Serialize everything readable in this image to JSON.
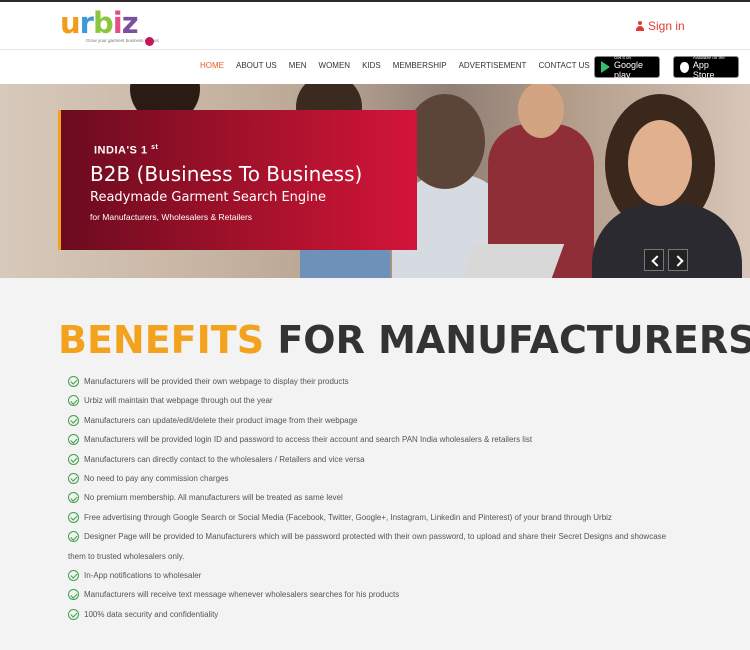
{
  "header": {
    "logo_text": "urbiz",
    "logo_tagline": "Grow your garment business with us",
    "signin_label": "Sign in"
  },
  "nav": {
    "items": [
      "HOME",
      "ABOUT US",
      "MEN",
      "WOMEN",
      "KIDS",
      "MEMBERSHIP",
      "ADVERTISEMENT",
      "CONTACT US"
    ],
    "active": "HOME"
  },
  "stores": {
    "google_small": "Get it on",
    "google_big": "Google play",
    "apple_small": "Available on the",
    "apple_big": "App Store"
  },
  "hero": {
    "line1": "INDIA'S 1",
    "line1_sup": "st",
    "line2": "B2B (Business To Business)",
    "line3": "Readymade Garment Search Engine",
    "line4": "for Manufacturers, Wholesalers & Retailers"
  },
  "benefits": {
    "title_highlight": "BENEFITS",
    "title_rest": "FOR MANUFACTURERS",
    "items": [
      "Manufacturers will be provided their own webpage to display their products",
      "Urbiz will maintain that webpage through out the year",
      "Manufacturers can update/edit/delete their product image from their webpage",
      "Manufacturers will be provided login ID and password to access their account and search PAN India wholesalers & retailers list",
      "Manufacturers can directly contact to the wholesalers / Retailers and vice versa",
      "No need to pay any commission charges",
      "No premium membership. All manufacturers will be treated as same level",
      "Free advertising through Google Search or Social Media (Facebook, Twitter, Google+, Instagram, Linkedin and Pinterest) of your brand through Urbiz",
      "Designer Page will be provided to Manufacturers which will be password protected with their own password, to upload and share their Secret Designs and showcase",
      "them to trusted wholesalers only.",
      "In-App notifications to wholesaler",
      "Manufacturers will receive text message whenever wholesalers searches for his products",
      "100% data security and confidentiality"
    ]
  },
  "colors": {
    "accent_orange": "#f2a21c",
    "nav_active": "#ea5a2a",
    "signin_red": "#e53935",
    "check_green": "#3da14a",
    "hero_card_start": "#6b0b1f",
    "hero_card_end": "#d3143a"
  },
  "icons": [
    "user-icon",
    "google-play-icon",
    "apple-icon",
    "chevron-left-icon",
    "chevron-right-icon",
    "check-circle-icon"
  ]
}
